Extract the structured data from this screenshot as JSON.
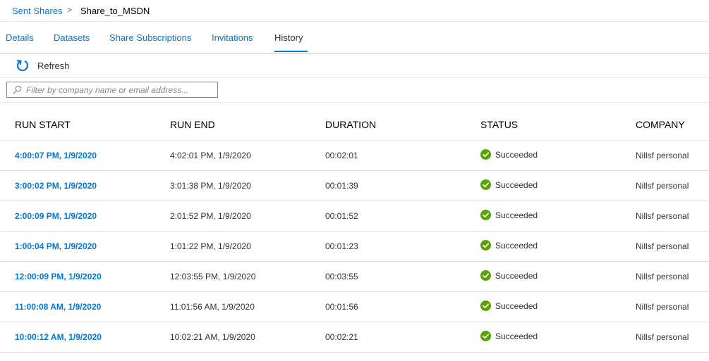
{
  "breadcrumb": {
    "parent": "Sent Shares",
    "separator": ">",
    "current": "Share_to_MSDN"
  },
  "tabs": [
    {
      "label": "Details",
      "active": false
    },
    {
      "label": "Datasets",
      "active": false
    },
    {
      "label": "Share Subscriptions",
      "active": false
    },
    {
      "label": "Invitations",
      "active": false
    },
    {
      "label": "History",
      "active": true
    }
  ],
  "toolbar": {
    "refresh_label": "Refresh",
    "refresh_icon": "refresh-icon"
  },
  "filter": {
    "placeholder": "Filter by company name or email address...",
    "value": "",
    "icon": "search-icon"
  },
  "table": {
    "headers": [
      "RUN START",
      "RUN END",
      "DURATION",
      "STATUS",
      "COMPANY"
    ],
    "rows": [
      {
        "run_start": "4:00:07 PM, 1/9/2020",
        "run_end": "4:02:01 PM, 1/9/2020",
        "duration": "00:02:01",
        "status": "Succeeded",
        "company": "Nillsf personal"
      },
      {
        "run_start": "3:00:02 PM, 1/9/2020",
        "run_end": "3:01:38 PM, 1/9/2020",
        "duration": "00:01:39",
        "status": "Succeeded",
        "company": "Nillsf personal"
      },
      {
        "run_start": "2:00:09 PM, 1/9/2020",
        "run_end": "2:01:52 PM, 1/9/2020",
        "duration": "00:01:52",
        "status": "Succeeded",
        "company": "Nillsf personal"
      },
      {
        "run_start": "1:00:04 PM, 1/9/2020",
        "run_end": "1:01:22 PM, 1/9/2020",
        "duration": "00:01:23",
        "status": "Succeeded",
        "company": "Nillsf personal"
      },
      {
        "run_start": "12:00:09 PM, 1/9/2020",
        "run_end": "12:03:55 PM, 1/9/2020",
        "duration": "00:03:55",
        "status": "Succeeded",
        "company": "Nillsf personal"
      },
      {
        "run_start": "11:00:08 AM, 1/9/2020",
        "run_end": "11:01:56 AM, 1/9/2020",
        "duration": "00:01:56",
        "status": "Succeeded",
        "company": "Nillsf personal"
      },
      {
        "run_start": "10:00:12 AM, 1/9/2020",
        "run_end": "10:02:21 AM, 1/9/2020",
        "duration": "00:02:21",
        "status": "Succeeded",
        "company": "Nillsf personal"
      }
    ]
  },
  "colors": {
    "accent": "#0078d4",
    "success": "#57a300",
    "text": "#323130"
  }
}
